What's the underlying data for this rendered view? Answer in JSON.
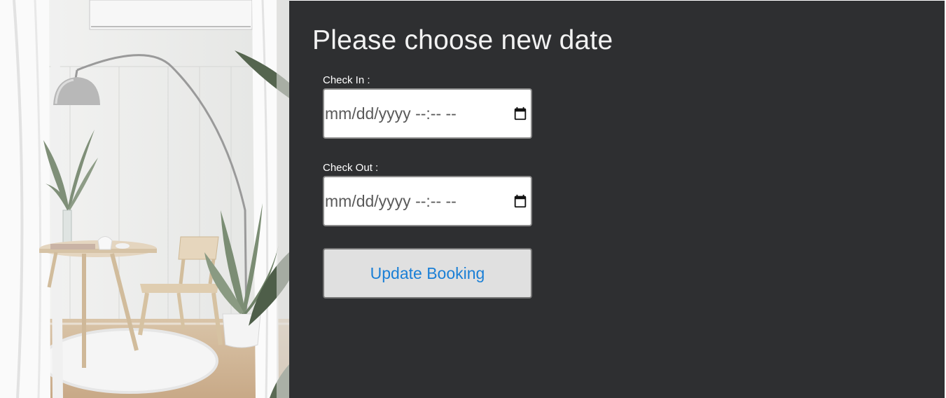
{
  "colors": {
    "panel_background": "#2e2f31",
    "title_text": "#f2f2f2",
    "button_text": "#1a7fd6",
    "button_background": "#e0e0e0"
  },
  "hero_image": {
    "icon": "interior-photo-lamp-table-chair-plants"
  },
  "form": {
    "title": "Please choose new date",
    "check_in": {
      "label": "Check In :",
      "value": "mm/dd/yyyy --:-- --",
      "icon": "calendar-icon"
    },
    "check_out": {
      "label": "Check Out :",
      "value": "mm/dd/yyyy --:-- --",
      "icon": "calendar-icon"
    },
    "submit_label": "Update Booking"
  }
}
